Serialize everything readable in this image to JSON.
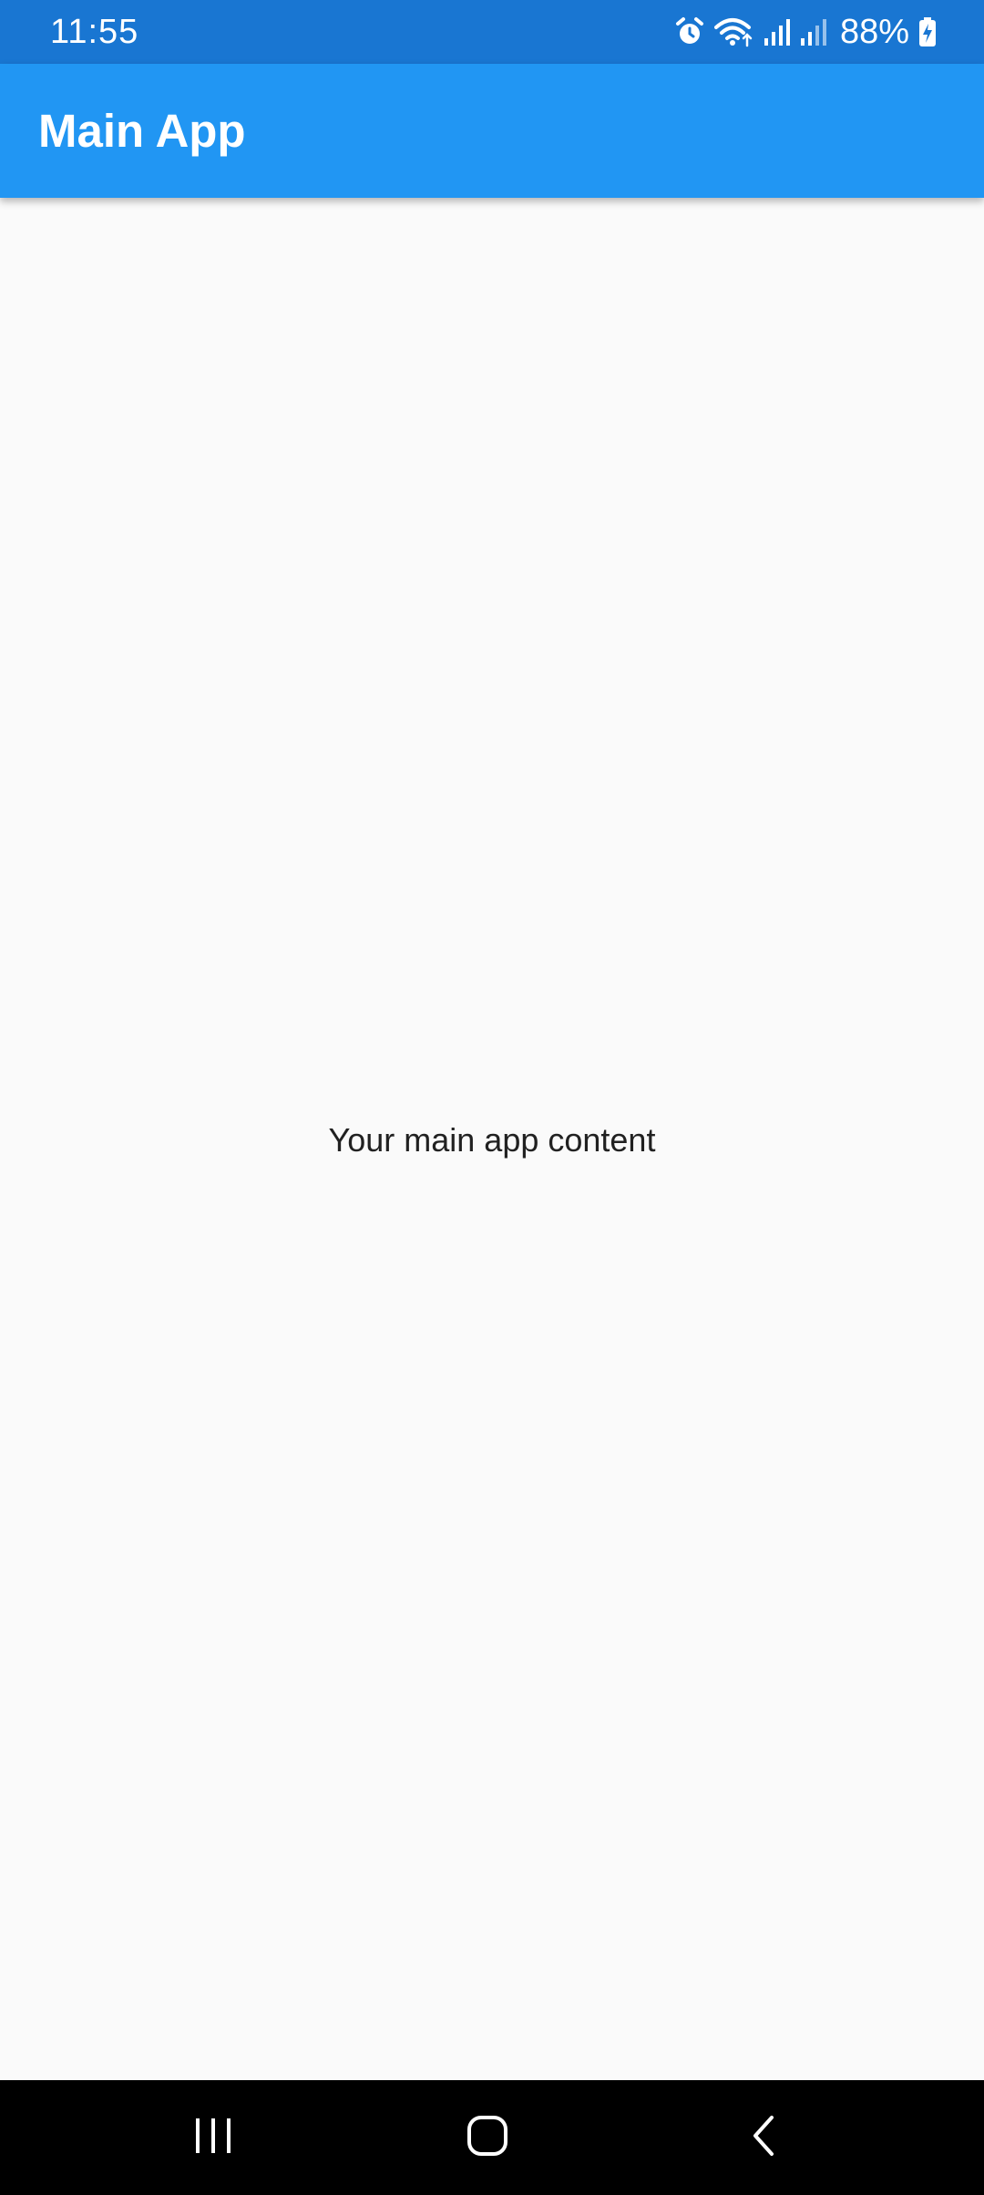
{
  "status_bar": {
    "time": "11:55",
    "battery_percent": "88%",
    "icons": [
      "alarm-icon",
      "wifi-icon",
      "signal-icon",
      "signal-icon",
      "battery-charging-icon"
    ]
  },
  "app_bar": {
    "title": "Main App",
    "color": "#2196f3"
  },
  "main": {
    "content_text": "Your main app content"
  },
  "nav_bar": {
    "buttons": [
      "recents-icon",
      "home-icon",
      "back-icon"
    ]
  },
  "colors": {
    "status_bar": "#1976d2",
    "app_bar": "#2196f3",
    "background": "#fafafa",
    "nav_bar": "#000000"
  }
}
